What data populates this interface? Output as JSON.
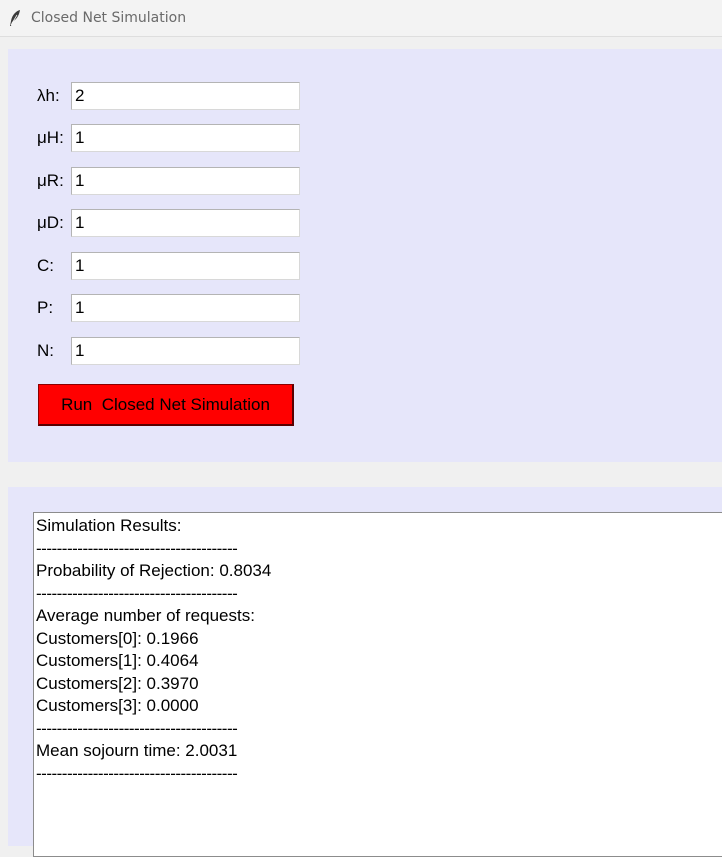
{
  "window": {
    "title": "Closed Net Simulation"
  },
  "form": {
    "fields": [
      {
        "label": "λh:",
        "value": "2"
      },
      {
        "label": "μH:",
        "value": "1"
      },
      {
        "label": "μR:",
        "value": "1"
      },
      {
        "label": "μD:",
        "value": "1"
      },
      {
        "label": "C:",
        "value": "1"
      },
      {
        "label": "P:",
        "value": "1"
      },
      {
        "label": "N:",
        "value": "1"
      }
    ],
    "run_button_label": "Run  Closed Net Simulation"
  },
  "results": {
    "lines": [
      "Simulation Results:",
      "---------------------------------------",
      "Probability of Rejection: 0.8034",
      "---------------------------------------",
      "Average number of requests:",
      "Customers[0]: 0.1966",
      "Customers[1]: 0.4064",
      "Customers[2]: 0.3970",
      "Customers[3]: 0.0000",
      "---------------------------------------",
      "Mean sojourn time: 2.0031",
      "---------------------------------------"
    ]
  },
  "colors": {
    "panel_background": "#e6e6fa",
    "run_button": "#ff0000"
  }
}
